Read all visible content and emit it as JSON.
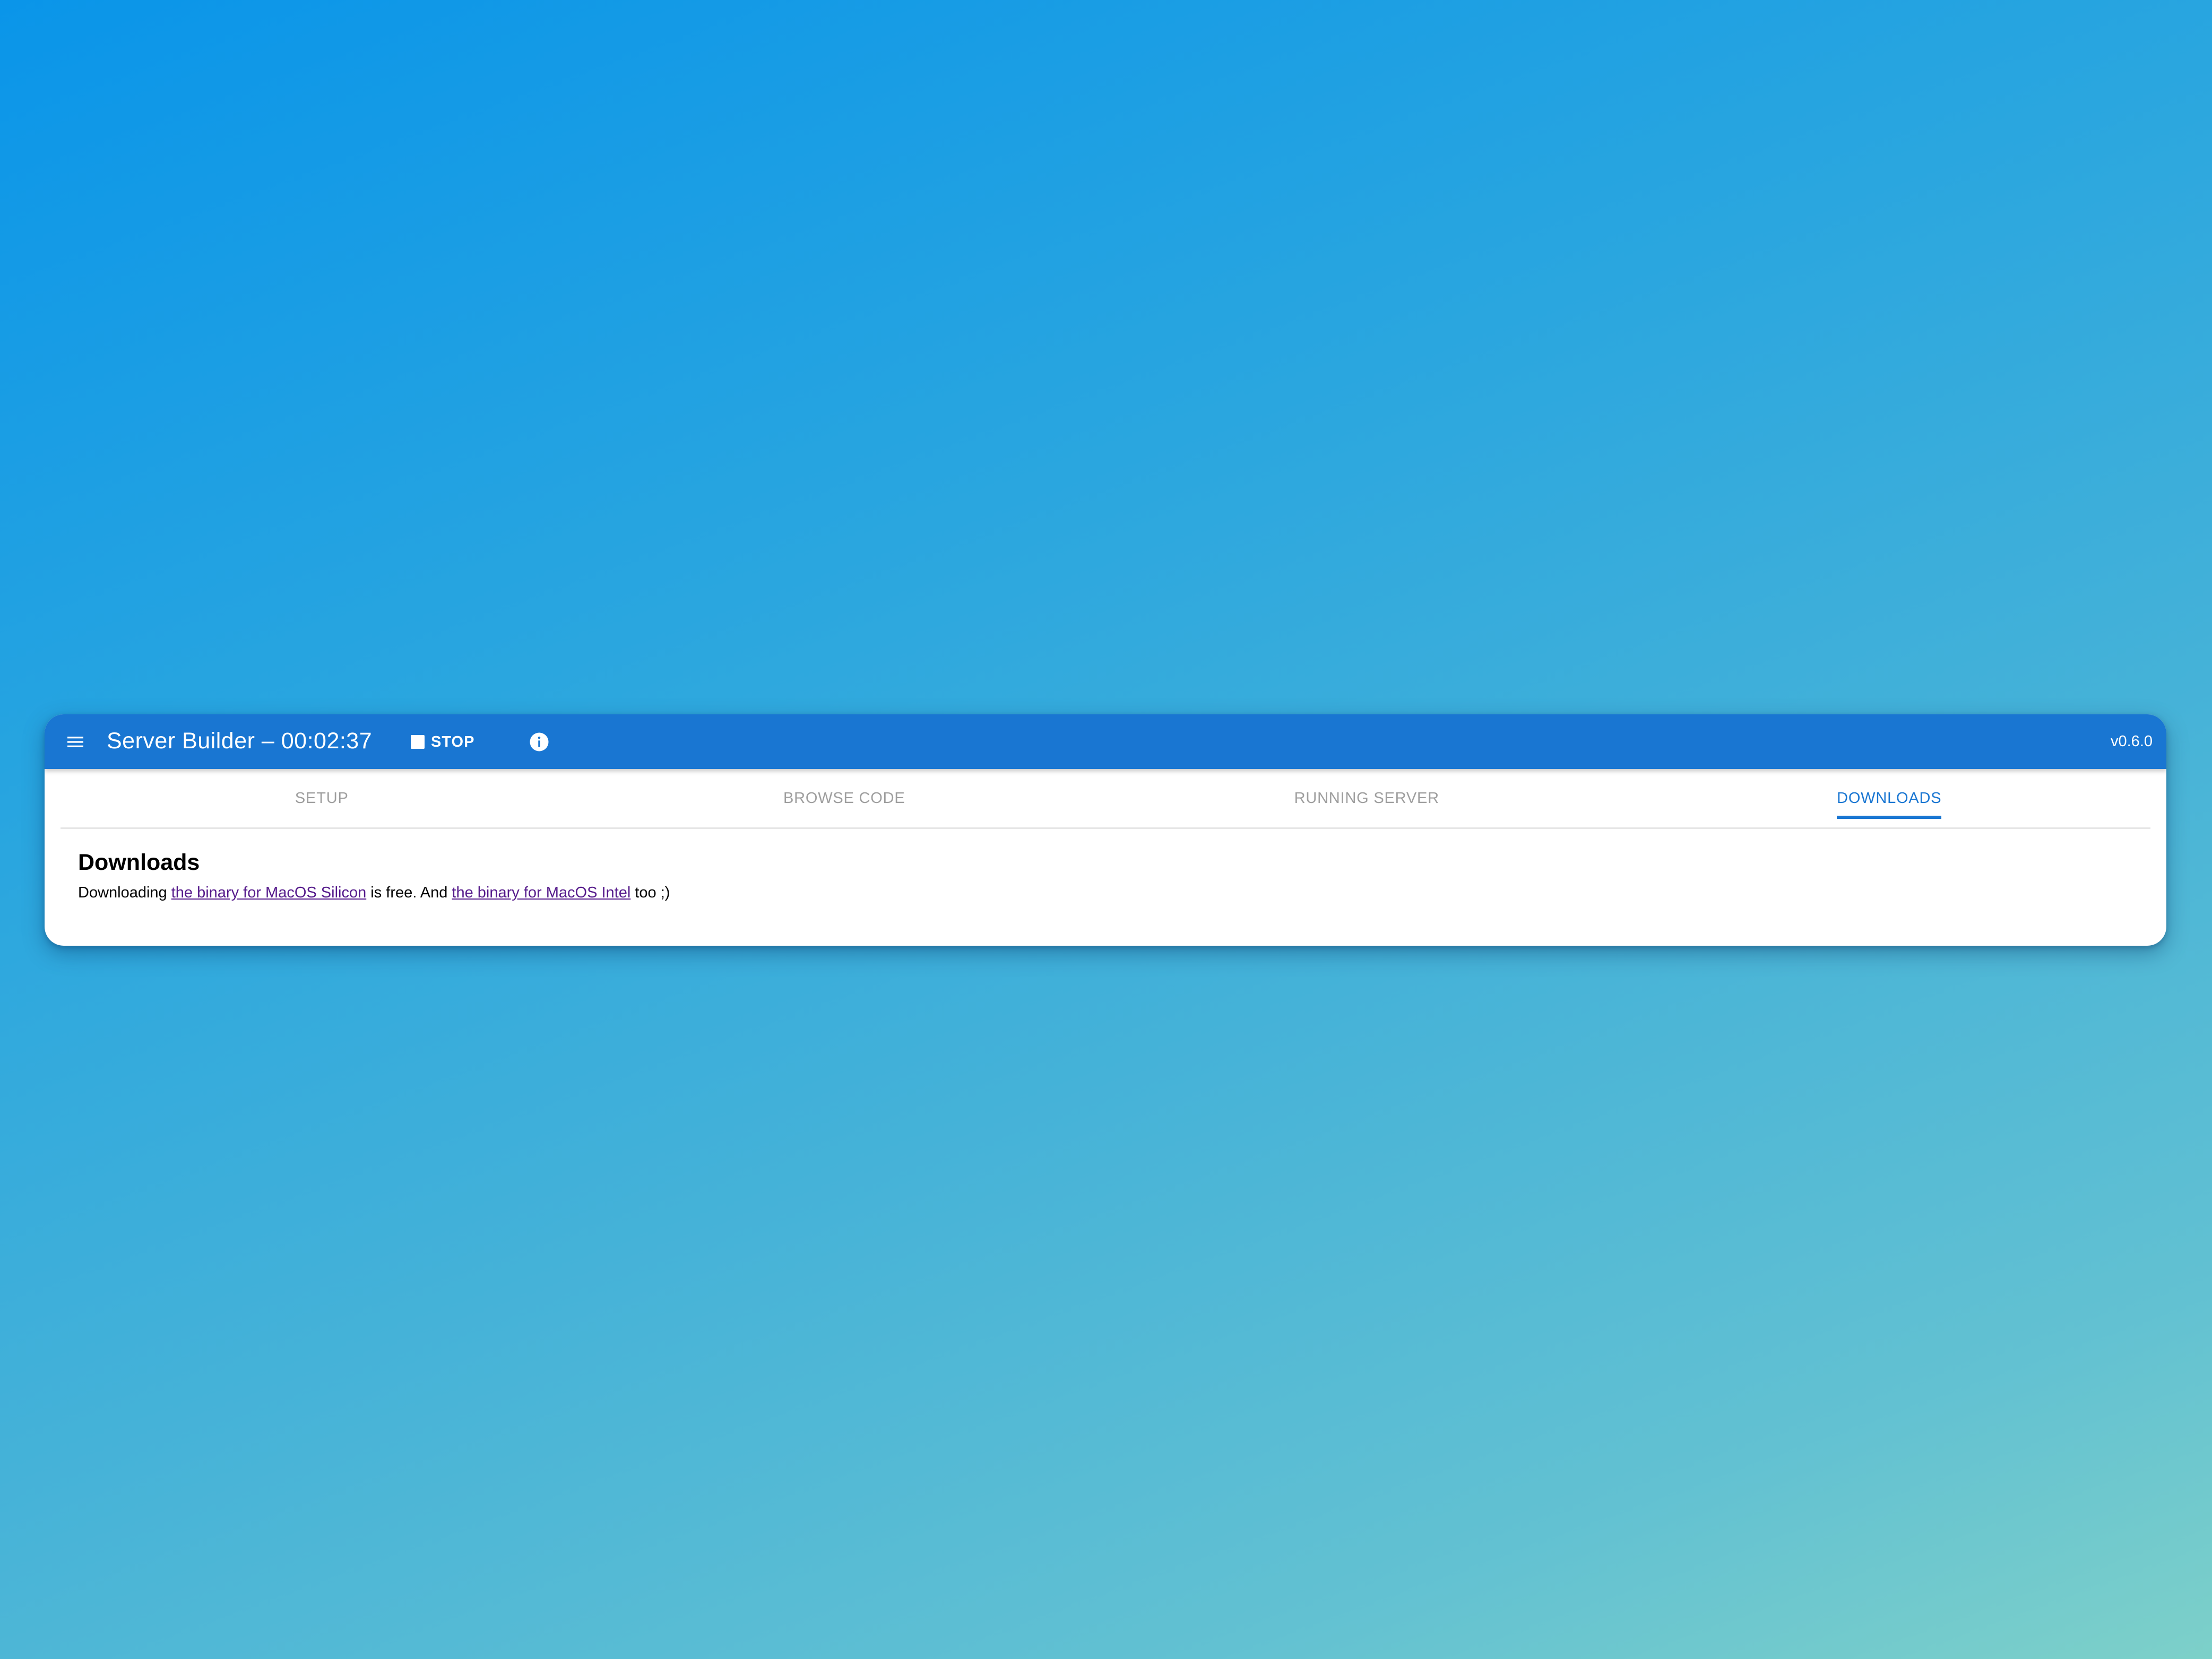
{
  "appbar": {
    "menu_icon": "menu-icon",
    "title": "Server Builder – 00:02:37",
    "stop_label": "STOP",
    "stop_icon": "stop-icon",
    "info_icon": "info-icon",
    "version": "v0.6.0",
    "background_color": "#1976d2"
  },
  "tabs": [
    {
      "label": "SETUP",
      "active": false
    },
    {
      "label": "BROWSE CODE",
      "active": false
    },
    {
      "label": "RUNNING SERVER",
      "active": false
    },
    {
      "label": "DOWNLOADS",
      "active": true
    }
  ],
  "content": {
    "heading": "Downloads",
    "text_before": "Downloading ",
    "link_silicon": "the binary for MacOS Silicon",
    "text_middle": " is free. And ",
    "link_intel": "the binary for MacOS Intel",
    "text_after": " too ;)"
  },
  "colors": {
    "accent": "#1976d2",
    "link": "#551a8b",
    "inactive_tab": "#9e9e9e"
  }
}
